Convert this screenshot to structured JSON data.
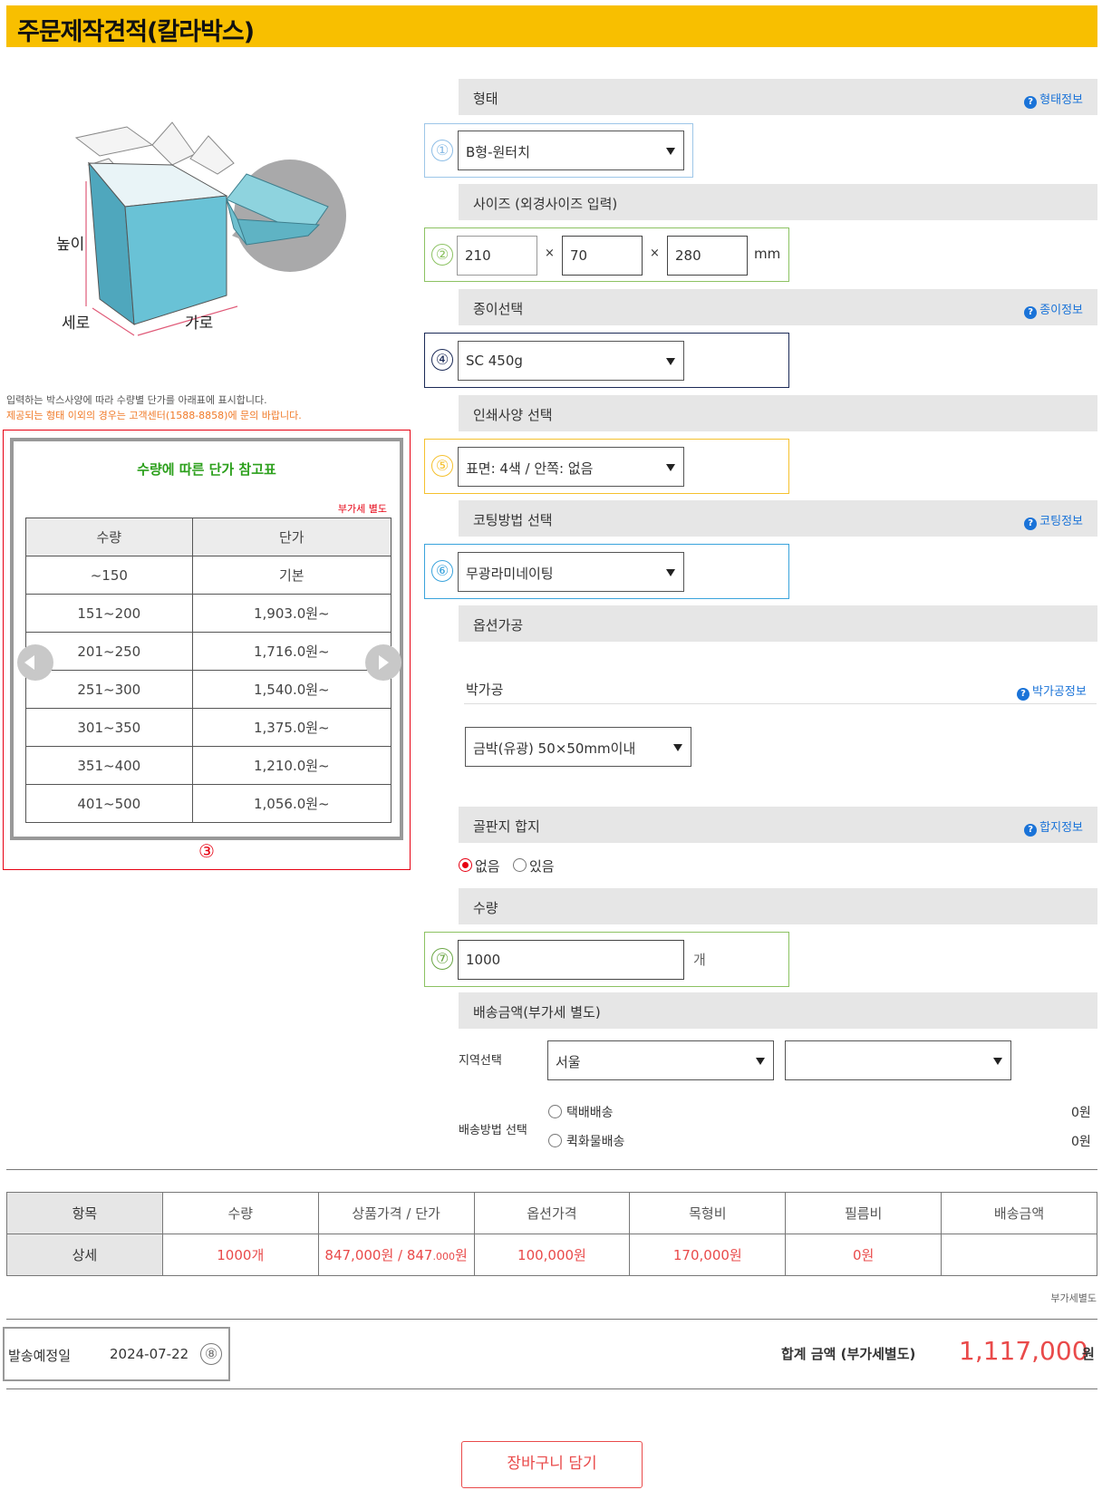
{
  "page_title": "주문제작견적(칼라박스)",
  "illustration": {
    "height_label": "높이",
    "depth_label": "세로",
    "width_label": "가로"
  },
  "notes": {
    "line1": "입력하는 박스사양에 따라 수량별 단가를 아래표에 표시합니다.",
    "line2": "제공되는 형태 이외의 경우는 고객센터(1588-8858)에 문의 바랍니다."
  },
  "price_table": {
    "title": "수량에 따른 단가 참고표",
    "vat_note": "부가세 별도",
    "headers": [
      "수량",
      "단가"
    ],
    "rows": [
      [
        "~150",
        "기본"
      ],
      [
        "151~200",
        "1,903.0원~"
      ],
      [
        "201~250",
        "1,716.0원~"
      ],
      [
        "251~300",
        "1,540.0원~"
      ],
      [
        "301~350",
        "1,375.0원~"
      ],
      [
        "351~400",
        "1,210.0원~"
      ],
      [
        "401~500",
        "1,056.0원~"
      ]
    ],
    "marker": "③"
  },
  "form": {
    "shape": {
      "label": "형태",
      "info": "형태정보",
      "marker": "①",
      "value": "B형-원터치"
    },
    "size": {
      "label": "사이즈 (외경사이즈 입력)",
      "marker": "②",
      "width": "210",
      "depth": "70",
      "height": "280",
      "times": "×",
      "unit": "mm"
    },
    "paper": {
      "label": "종이선택",
      "info": "종이정보",
      "marker": "④",
      "value": "SC 450g"
    },
    "print": {
      "label": "인쇄사양 선택",
      "marker": "⑤",
      "value": "표면: 4색 / 안쪽: 없음"
    },
    "coating": {
      "label": "코팅방법 선택",
      "info": "코팅정보",
      "marker": "⑥",
      "value": "무광라미네이팅"
    },
    "option": {
      "label": "옵션가공"
    },
    "foil": {
      "label": "박가공",
      "info": "박가공정보",
      "value": "금박(유광) 50×50mm이내"
    },
    "laminate": {
      "label": "골판지 합지",
      "info": "합지정보",
      "opt_none": "없음",
      "opt_yes": "있음"
    },
    "quantity": {
      "label": "수량",
      "marker": "⑦",
      "value": "1000",
      "unit": "개"
    },
    "delivery": {
      "label": "배송금액(부가세 별도)",
      "region_label": "지역선택",
      "region_value": "서울",
      "region2_value": "",
      "method_label": "배송방법 선택",
      "methods": [
        {
          "name": "택배배송",
          "price": "0원"
        },
        {
          "name": "퀵화물배송",
          "price": "0원"
        }
      ]
    }
  },
  "summary": {
    "headers": [
      "항목",
      "수량",
      "상품가격 / 단가",
      "옵션가격",
      "목형비",
      "필름비",
      "배송금액"
    ],
    "row_label": "상세",
    "qty": "1000개",
    "price_main": "847,000원 / 847",
    "price_small": ".000",
    "price_unit": "원",
    "option": "100,000원",
    "die": "170,000원",
    "film": "0원",
    "ship": "",
    "vat_note": "부가세별도"
  },
  "ship_date": {
    "label": "발송예정일",
    "value": "2024-07-22",
    "marker": "⑧"
  },
  "total": {
    "label": "합계 금액 (부가세별도)",
    "value": "1,117,000",
    "unit": "원"
  },
  "cart_button": "장바구니 담기",
  "colors": {
    "accent": "#f8bf00",
    "red": "#e60012",
    "green": "#2ca01c",
    "blue": "#1a73d8"
  }
}
